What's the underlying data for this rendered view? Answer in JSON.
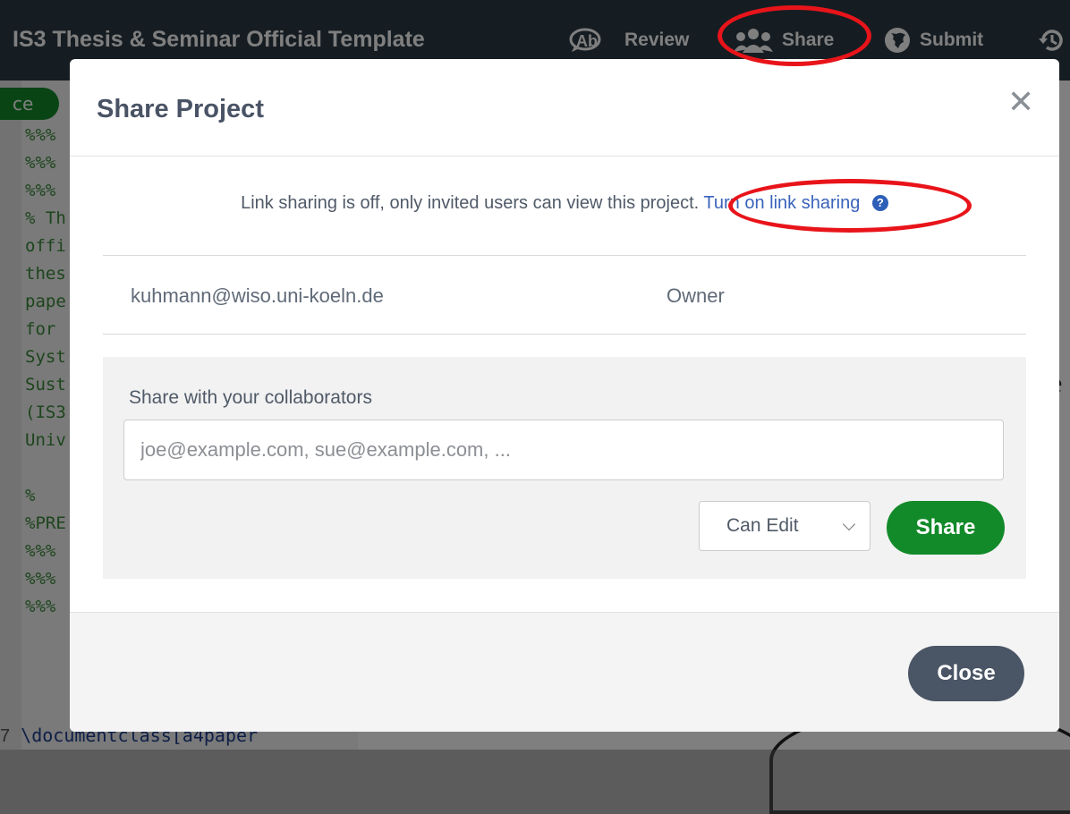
{
  "topbar": {
    "project_title": "IS3 Thesis & Seminar Official Template",
    "review_label": "Review",
    "share_label": "Share",
    "submit_label": "Submit"
  },
  "editor": {
    "pill_label": "ce",
    "lines": [
      "%%%",
      "%%%",
      "%%%",
      "% Th",
      "offi",
      "thes",
      "pape",
      "for",
      "Syst",
      "Sust",
      "(IS3",
      "Univ",
      "",
      "%",
      "%PRE",
      "%%%",
      "%%%",
      "%%%"
    ],
    "bottom_line_number": "7",
    "bottom_line_code": "\\documentclass[a4paper"
  },
  "pdf": {
    "fragment": "e"
  },
  "modal": {
    "title": "Share Project",
    "link_sharing_text": "Link sharing is off, only invited users can view this project.",
    "link_sharing_action": "Turn on link sharing",
    "member": {
      "email": "kuhmann@wiso.uni-koeln.de",
      "role": "Owner"
    },
    "share_with_label": "Share with your collaborators",
    "email_placeholder": "joe@example.com, sue@example.com, ...",
    "permission_selected": "Can Edit",
    "share_button": "Share",
    "close_button": "Close"
  },
  "colors": {
    "topbar_bg": "#2d3a44",
    "share_green": "#138a29",
    "link_blue": "#3a63ba",
    "close_button_bg": "#4a5565",
    "highlight_red": "#e8141a"
  }
}
